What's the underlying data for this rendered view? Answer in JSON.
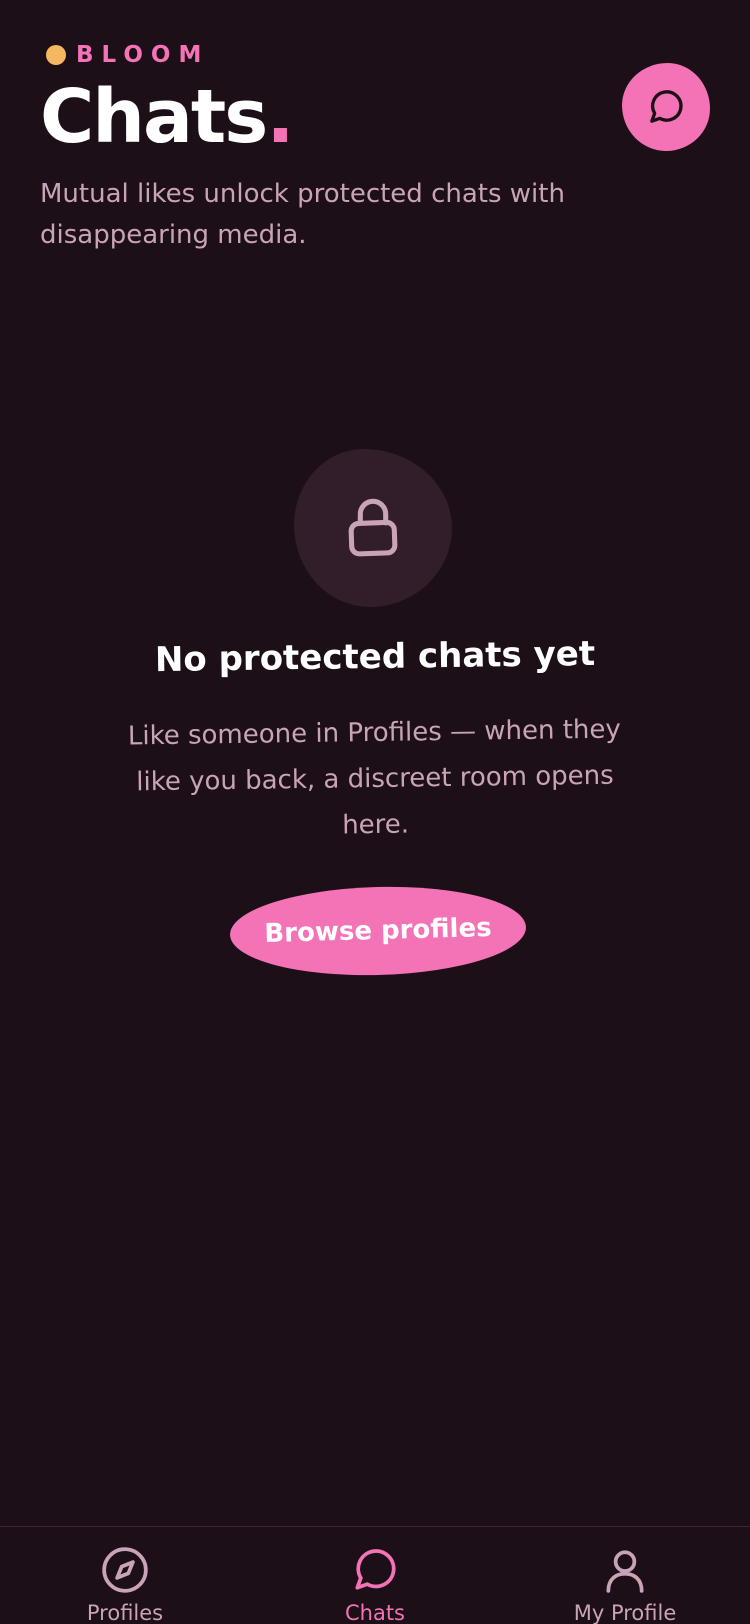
{
  "brand": {
    "name": "BLOOM",
    "dot_color": "#f4b860",
    "accent_color": "#f472b6"
  },
  "header": {
    "title": "Chats",
    "title_suffix": ".",
    "compose_icon": "chat-bubble-icon"
  },
  "subtitle": "Mutual likes unlock protected chats with disappearing media.",
  "empty_state": {
    "icon": "lock-icon",
    "title": "No protected chats yet",
    "description": "Like someone in Profiles — when they like you back, a discreet room opens here.",
    "button_label": "Browse profiles"
  },
  "tabbar": {
    "active": "Chats",
    "items": [
      {
        "label": "Profiles",
        "icon": "compass-icon"
      },
      {
        "label": "Chats",
        "icon": "chat-bubble-icon"
      },
      {
        "label": "My Profile",
        "icon": "user-icon"
      }
    ]
  },
  "colors": {
    "background": "#1c0f18",
    "muted_text": "#c9a3b8",
    "blob": "#321d2b"
  }
}
